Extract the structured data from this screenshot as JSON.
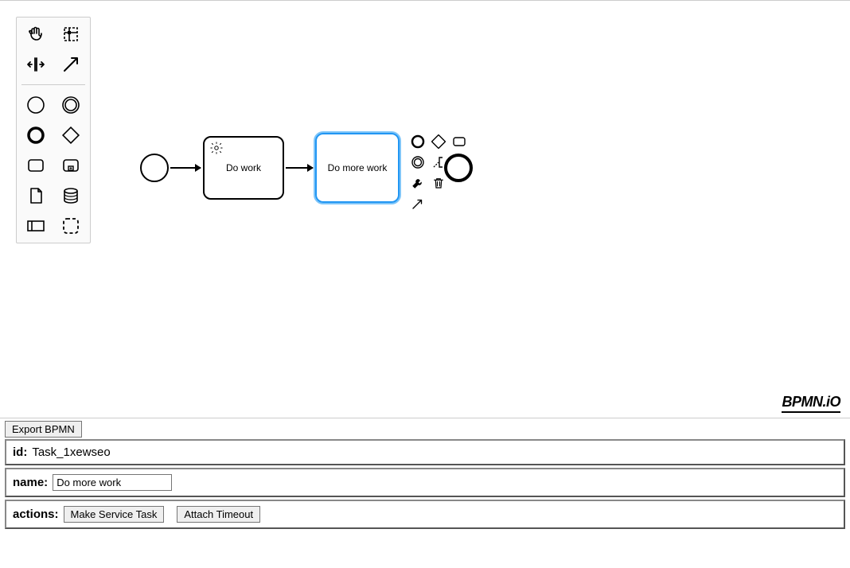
{
  "canvas": {
    "tasks": [
      {
        "label": "Do work"
      },
      {
        "label": "Do more work"
      }
    ]
  },
  "brand": "BPMN.iO",
  "panel": {
    "export_label": "Export BPMN",
    "id_label": "id:",
    "id_value": "Task_1xewseo",
    "name_label": "name:",
    "name_value": "Do more work",
    "actions_label": "actions:",
    "make_service_task": "Make Service Task",
    "attach_timeout": "Attach Timeout"
  }
}
